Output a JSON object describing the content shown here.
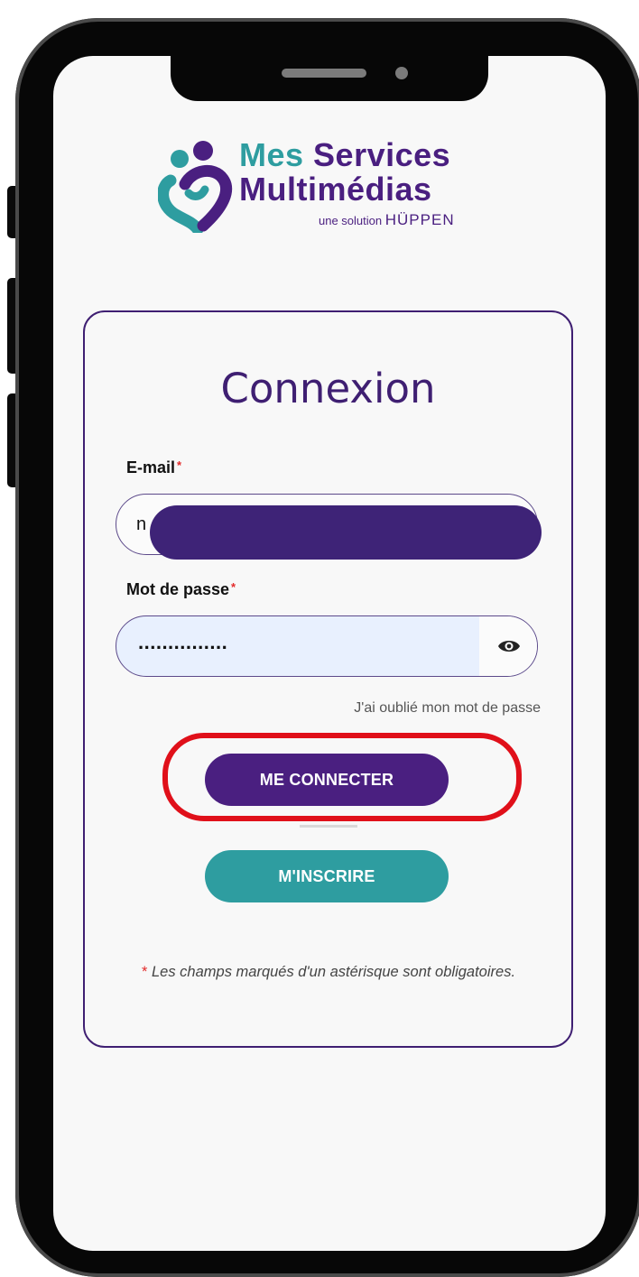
{
  "brand": {
    "name_part1": "Mes",
    "name_part2": "Services",
    "name_line2": "Multimédias",
    "tagline": "une solution",
    "tagline_brand": "HÜPPEN"
  },
  "login": {
    "title": "Connexion",
    "email_label": "E-mail",
    "email_value_visible": "n",
    "password_label": "Mot de passe",
    "password_masked": "...............",
    "required_mark": "*",
    "forgot_link": "J'ai oublié mon mot de passe",
    "login_button": "ME CONNECTER",
    "signup_button": "M'INSCRIRE",
    "required_note": "Les champs marqués d'un astérisque sont obligatoires."
  },
  "icons": {
    "logo": "heart-people-logo-icon",
    "password_toggle": "eye-icon"
  },
  "colors": {
    "brand_purple": "#4a1f80",
    "brand_teal": "#2e9da0",
    "highlight_red": "#e0101a",
    "required_red": "#e32b2b"
  }
}
